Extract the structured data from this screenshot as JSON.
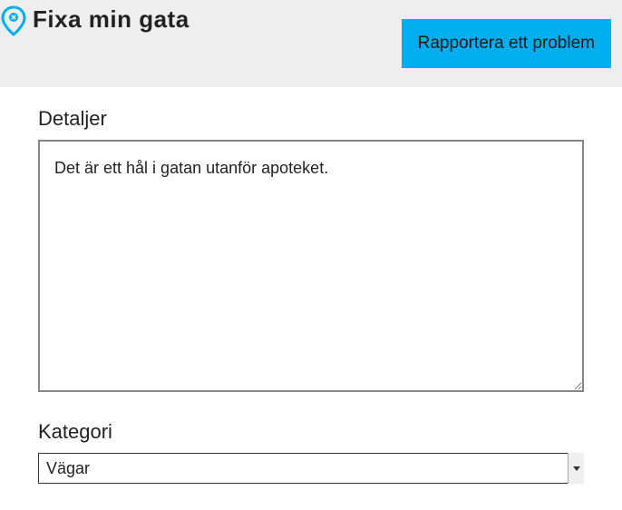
{
  "header": {
    "logo_text": "Fixa min gata",
    "report_button_label": "Rapportera ett problem"
  },
  "form": {
    "details_label": "Detaljer",
    "details_value": "Det är ett hål i gatan utanför apoteket.",
    "category_label": "Kategori",
    "category_selected": "Vägar"
  },
  "colors": {
    "header_bg": "#eeeeee",
    "accent": "#00adee",
    "text": "#222222"
  }
}
